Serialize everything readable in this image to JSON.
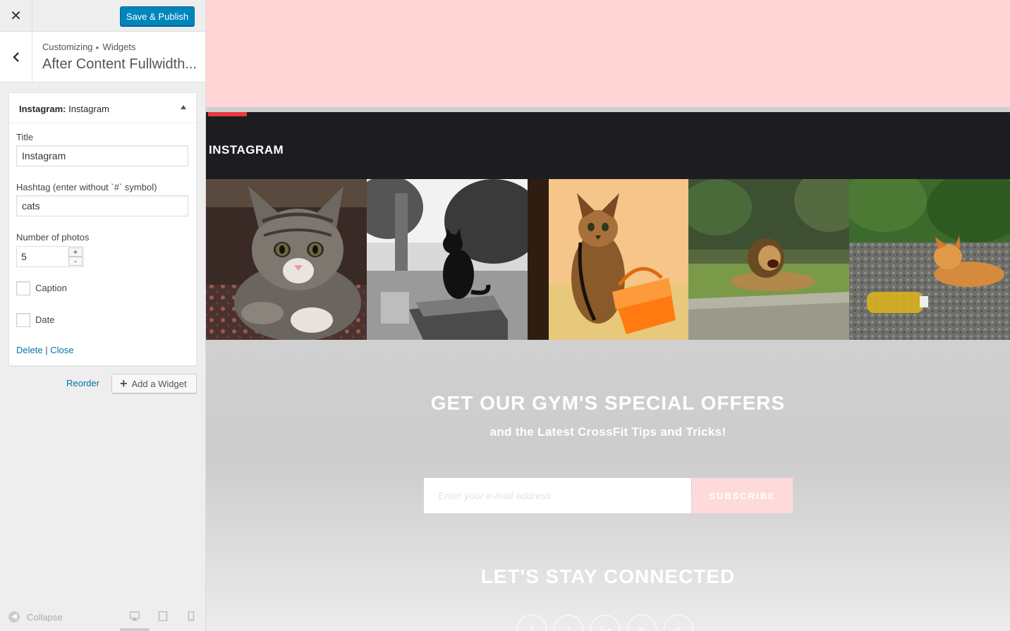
{
  "customizer": {
    "close_label": "✕",
    "save_label": "Save & Publish",
    "breadcrumb": {
      "root": "Customizing",
      "separator": "▸",
      "current": "Widgets"
    },
    "section_title": "After Content Fullwidth...",
    "widget": {
      "type_label": "Instagram:",
      "instance_title": "Instagram",
      "fields": {
        "title_label": "Title",
        "title_value": "Instagram",
        "hashtag_label": "Hashtag (enter without `#` symbol)",
        "hashtag_value": "cats",
        "number_label": "Number of photos",
        "number_value": "5",
        "caption_label": "Caption",
        "date_label": "Date"
      },
      "actions": {
        "delete": "Delete",
        "divider": "|",
        "close": "Close"
      }
    },
    "reorder_label": "Reorder",
    "add_widget_label": "Add a Widget",
    "collapse_label": "Collapse",
    "accent_color": "#0085ba"
  },
  "preview": {
    "instagram_title": "INSTAGRAM",
    "photos": [
      {
        "subject": "tabby kitten on rug"
      },
      {
        "subject": "black cat on stone block, black and white"
      },
      {
        "subject": "painted cat with orange bag"
      },
      {
        "subject": "lion lying on grass"
      },
      {
        "subject": "orange cat near bottle on gravel"
      }
    ],
    "offer_title": "GET OUR GYM'S SPECIAL OFFERS",
    "offer_subtitle": "and the Latest CrossFit Tips and Tricks!",
    "email_placeholder": "Enter your e-mail address",
    "subscribe_label": "SUBSCRIBE",
    "connected_title": "LET'S STAY CONNECTED",
    "social_icons": [
      "facebook-icon",
      "twitter-icon",
      "google-plus-icon",
      "linkedin-icon",
      "pinterest-icon"
    ],
    "colors": {
      "pink": "#ffd5d5",
      "dark_bar": "#1c1c21",
      "accent_red": "#e8393f"
    }
  }
}
